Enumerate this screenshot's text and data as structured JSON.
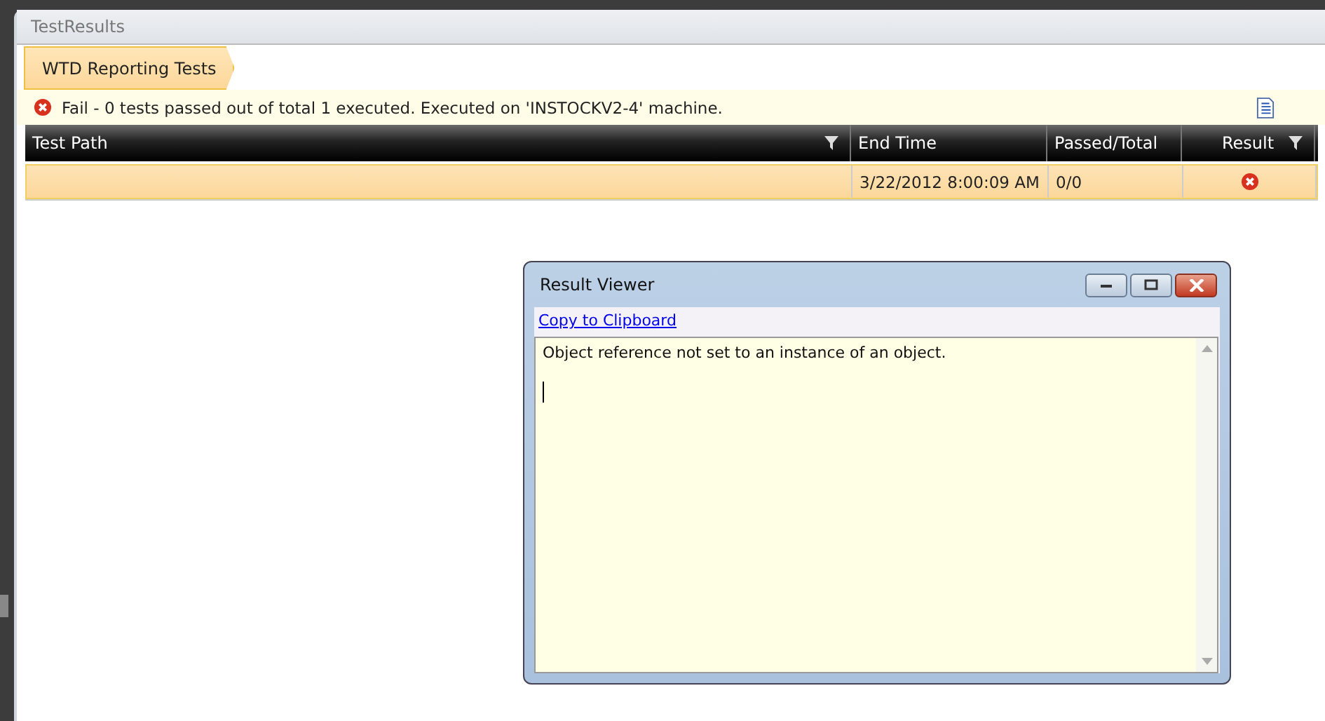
{
  "panel": {
    "title": "TestResults"
  },
  "breadcrumb": [
    {
      "label": "WTD Reporting Tests",
      "selected": true
    }
  ],
  "summary": {
    "kind": "fail",
    "text": "Fail - 0 tests passed out of total 1 executed. Executed on 'INSTOCKV2-4' machine."
  },
  "grid": {
    "columns": [
      {
        "label": "Test Path",
        "filterable": true
      },
      {
        "label": "End Time",
        "filterable": false
      },
      {
        "label": "Passed/Total",
        "filterable": false
      },
      {
        "label": "Result",
        "filterable": true
      }
    ],
    "rows": [
      {
        "selected": true,
        "end_time": "3/22/2012 8:00:09 AM",
        "passed_total": "0/0",
        "result": {
          "kind": "fail"
        }
      }
    ]
  },
  "dialog": {
    "title": "Result Viewer",
    "link": "Copy to Clipboard",
    "text": "Object reference not set to an instance of an object."
  }
}
